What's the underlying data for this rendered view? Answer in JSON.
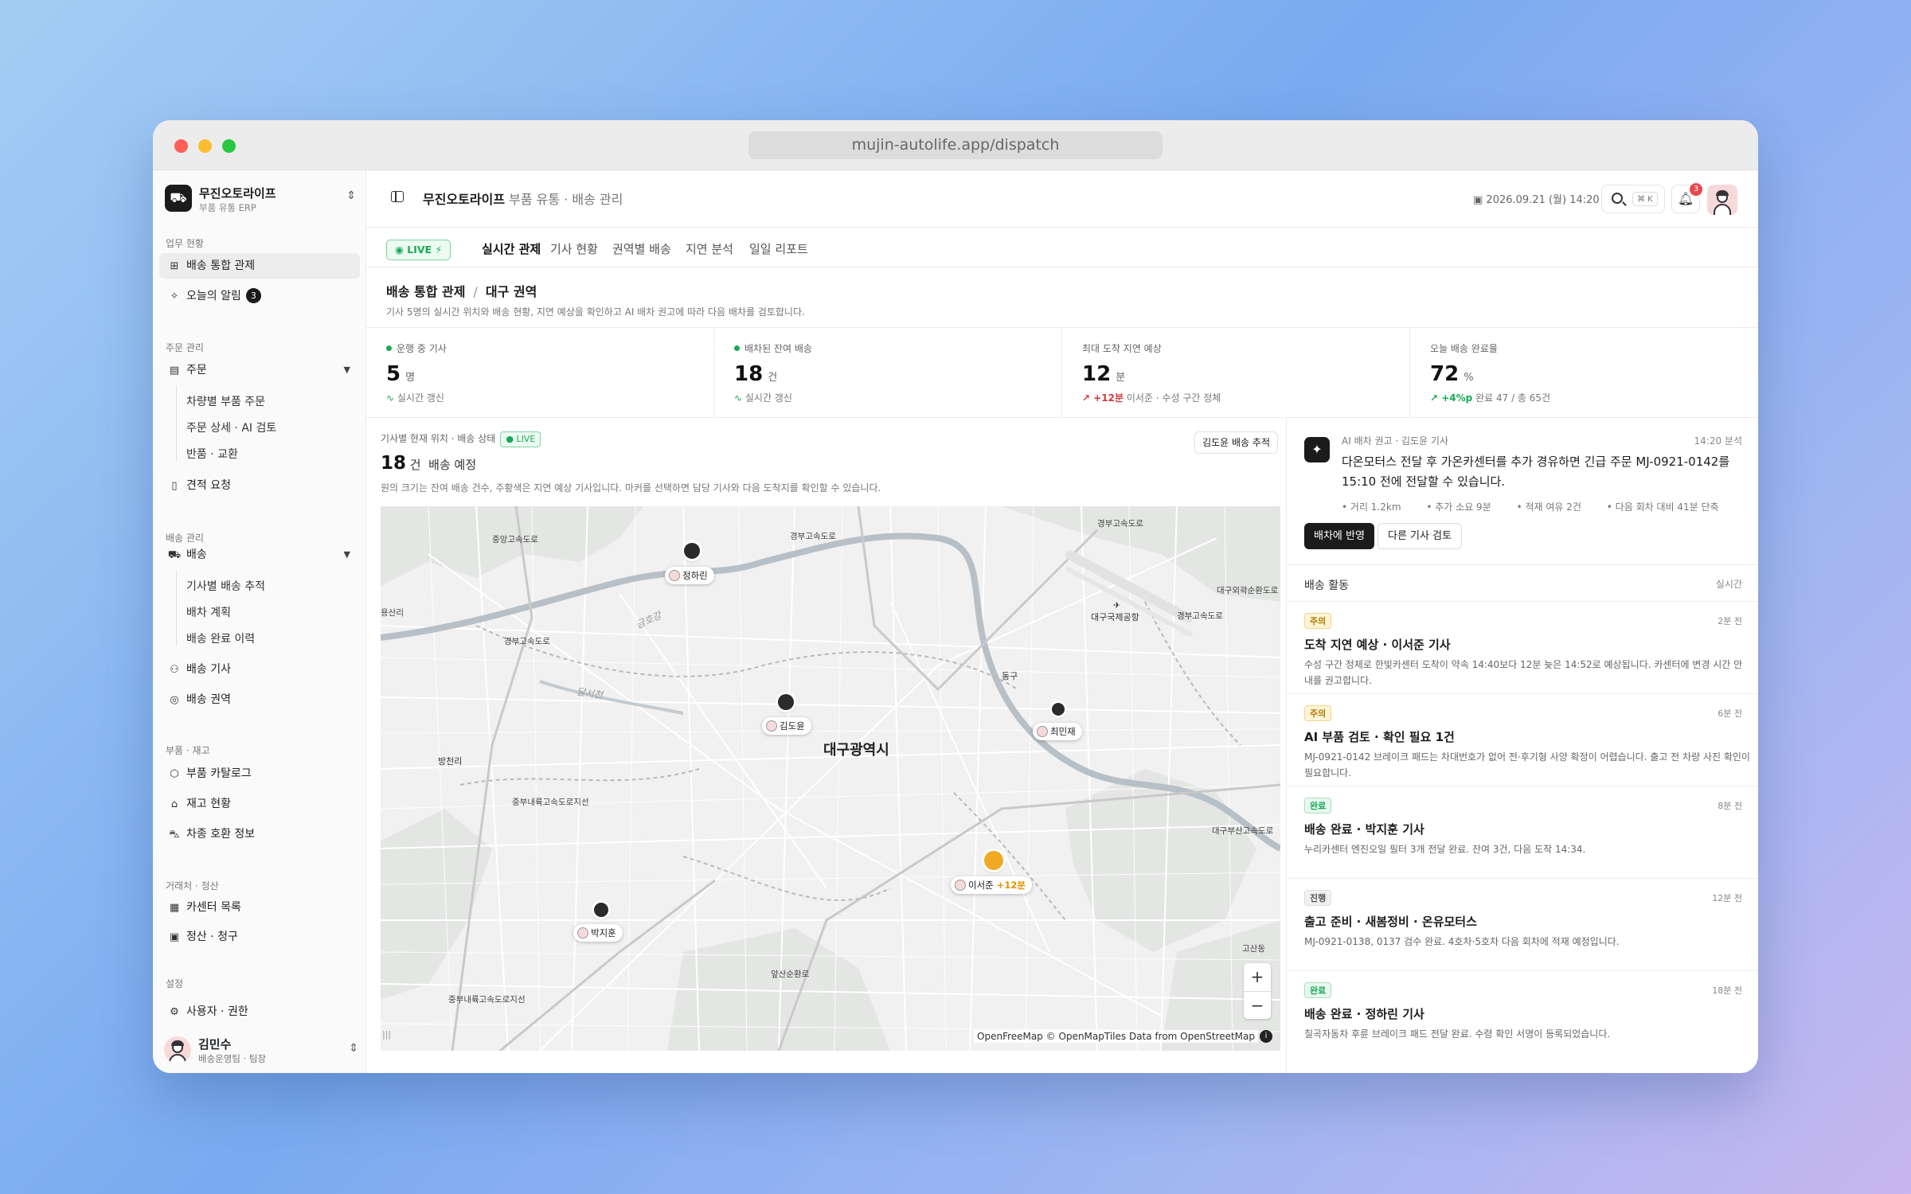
{
  "browser": {
    "url": "mujin-autolife.app/dispatch"
  },
  "brand": {
    "name": "무진오토라이프",
    "sub": "부품 유통 ERP"
  },
  "sidebar": {
    "sections": {
      "work": "업무 현황",
      "orders": "주문 관리",
      "delivery": "배송 관리",
      "parts": "부품 · 재고",
      "partners": "거래처 · 정산",
      "settings": "설정"
    },
    "items": {
      "dispatch": "배송 통합 관제",
      "alerts": "오늘의 알림",
      "alerts_count": "3",
      "orders": "주문",
      "order_sub": [
        "차량별 부품 주문",
        "주문 상세 · AI 검토",
        "반품 · 교환"
      ],
      "quote": "견적 요청",
      "delivery": "배송",
      "delivery_sub": [
        "기사별 배송 추적",
        "배차 계획",
        "배송 완료 이력"
      ],
      "drivers": "배송 기사",
      "regions": "배송 권역",
      "catalog": "부품 카탈로그",
      "stock": "재고 현황",
      "compat": "차종 호환 정보",
      "centers": "카센터 목록",
      "billing": "정산 · 청구",
      "users": "사용자 · 권한"
    },
    "user": {
      "name": "김민수",
      "role": "배송운영팀 · 팀장"
    }
  },
  "topbar": {
    "title": "무진오토라이프",
    "subtitle": "부품 유통 · 배송 관리",
    "datetime": "2026.09.21 (월) 14:20",
    "shortcut": "⌘ K",
    "notif_count": "3"
  },
  "tabs": {
    "live": "LIVE",
    "items": [
      "실시간 관제",
      "기사 현황",
      "권역별 배송",
      "지연 분석",
      "일일 리포트"
    ]
  },
  "header": {
    "title": "배송 통합 관제",
    "region": "대구 권역",
    "desc": "기사 5명의 실시간 위치와 배송 현황, 지연 예상을 확인하고 AI 배차 권고에 따라 다음 배차를 검토합니다."
  },
  "kpis": [
    {
      "label": "운행 중 기사",
      "value": "5",
      "unit": "명",
      "foot": "실시간 갱신"
    },
    {
      "label": "배차된 잔여 배송",
      "value": "18",
      "unit": "건",
      "foot": "실시간 갱신"
    },
    {
      "label": "최대 도착 지연 예상",
      "value": "12",
      "unit": "분",
      "foot_hl": "+12분",
      "foot": "이서준 · 수성 구간 정체"
    },
    {
      "label": "오늘 배송 완료율",
      "value": "72",
      "unit": "%",
      "foot_hl": "+4%p",
      "foot": "완료 47 / 총 65건"
    }
  ],
  "map": {
    "label": "기사별 현재 위치 · 배송 상태",
    "live": "LIVE",
    "count": "18",
    "count_unit": "건",
    "count_suffix": "배송 예정",
    "desc": "원의 크기는 잔여 배송 건수, 주황색은 지연 예상 기사입니다. 마커를 선택하면 담당 기사와 다음 도착지를 확인할 수 있습니다.",
    "track_btn": "김도윤 배송 추적",
    "city": "대구광역시",
    "places": [
      "중앙고속도로",
      "경부고속도로",
      "경부고속도로",
      "경부고속도로",
      "경부고속도로",
      "중부내륙고속도로지선",
      "중부내륙고속도로지선",
      "방천리",
      "동구",
      "대구국제공항",
      "대구외곽순환도로",
      "대구부산고속도로",
      "앞산순환로",
      "달서천",
      "금호강",
      "고산동",
      "용산리"
    ],
    "drivers": [
      {
        "name": "정하린",
        "delay": ""
      },
      {
        "name": "김도윤",
        "delay": ""
      },
      {
        "name": "최민재",
        "delay": ""
      },
      {
        "name": "이서준",
        "delay": "+12분"
      },
      {
        "name": "박지훈",
        "delay": ""
      }
    ],
    "attribution": "OpenFreeMap © OpenMapTiles Data from OpenStreetMap",
    "zoom_in": "+",
    "zoom_out": "−",
    "info": "i",
    "handle": "|||"
  },
  "ai": {
    "label": "AI 배차 권고 · 김도윤 기사",
    "time": "14:20 분석",
    "text": "다온모터스 전달 후 가온카센터를 추가 경유하면 긴급 주문 MJ-0921-0142를 15:10 전에 전달할 수 있습니다.",
    "meta": [
      "거리 1.2km",
      "추가 소요 9분",
      "적재 여유 2건",
      "다음 회차 대비 41분 단축"
    ],
    "apply": "배차에 반영",
    "other": "다른 기사 검토"
  },
  "feed": {
    "title": "배송 활동",
    "realtime": "실시간",
    "items": [
      {
        "badge": "주의",
        "kind": "warn",
        "time": "2분 전",
        "title": "도착 지연 예상 · 이서준 기사",
        "desc": "수성 구간 정체로 한빛카센터 도착이 약속 14:40보다 12분 늦은 14:52로 예상됩니다. 카센터에 변경 시간 안내를 권고합니다."
      },
      {
        "badge": "주의",
        "kind": "warn",
        "time": "6분 전",
        "title": "AI 부품 검토 · 확인 필요 1건",
        "desc": "MJ-0921-0142 브레이크 패드는 차대번호가 없어 전·후기형 사양 확정이 어렵습니다. 출고 전 차량 사진 확인이 필요합니다."
      },
      {
        "badge": "완료",
        "kind": "done",
        "time": "8분 전",
        "title": "배송 완료 · 박지훈 기사",
        "desc": "누리카센터 엔진오일 필터 3개 전달 완료. 잔여 3건, 다음 도착 14:34."
      },
      {
        "badge": "진행",
        "kind": "prog",
        "time": "12분 전",
        "title": "출고 준비 · 새봄정비 · 온유모터스",
        "desc": "MJ-0921-0138, 0137 검수 완료. 4호차·5호차 다음 회차에 적재 예정입니다."
      },
      {
        "badge": "완료",
        "kind": "done",
        "time": "18분 전",
        "title": "배송 완료 · 정하린 기사",
        "desc": "칠곡자동차 후륜 브레이크 패드 전달 완료. 수령 확인 서명이 등록되었습니다."
      }
    ]
  }
}
